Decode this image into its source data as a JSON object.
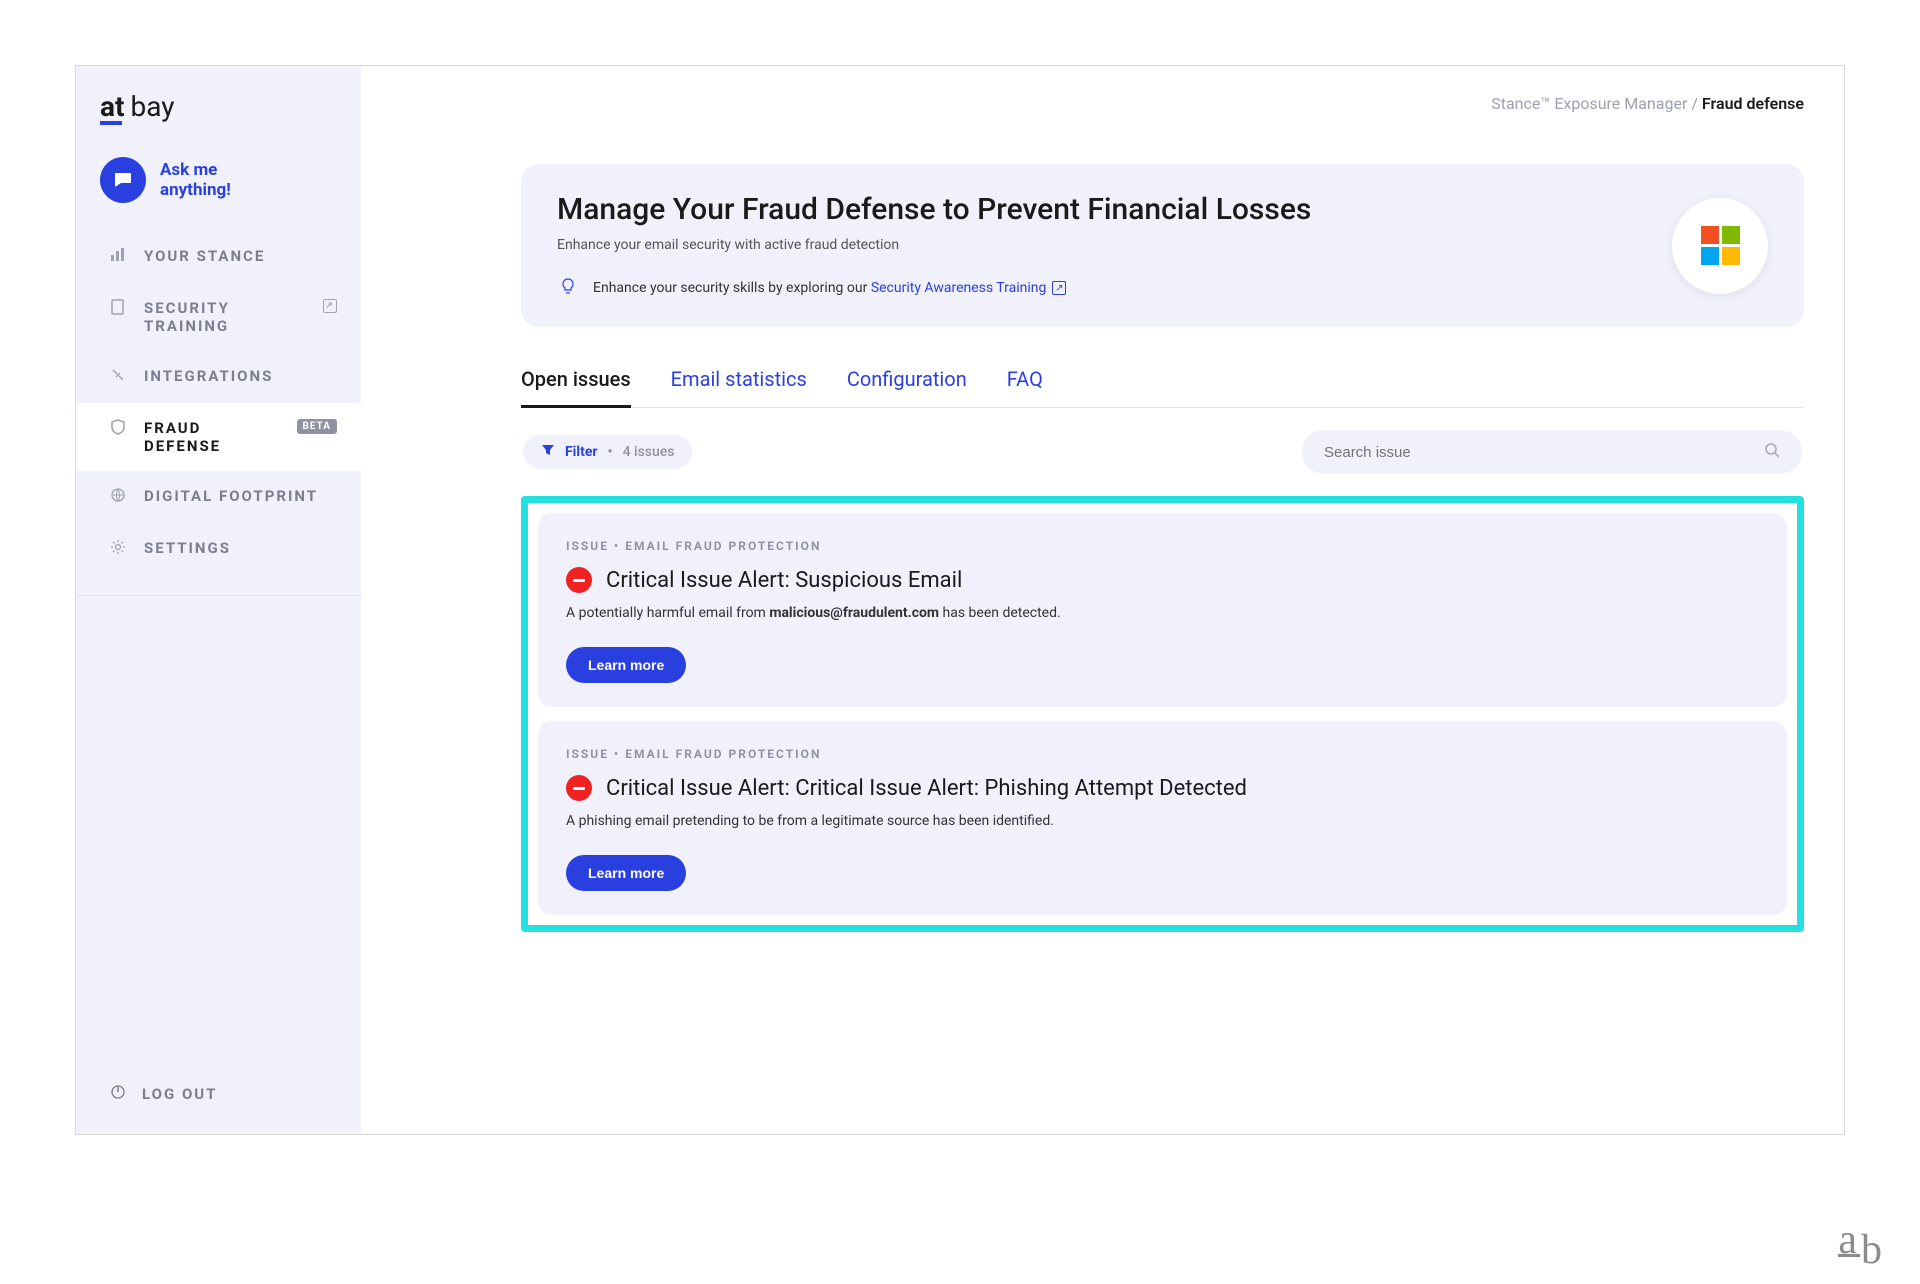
{
  "logo": {
    "part1": "at",
    "part2": "bay"
  },
  "ask": {
    "line1": "Ask me",
    "line2": "anything!"
  },
  "sidebar": {
    "items": [
      {
        "label": "YOUR STANCE"
      },
      {
        "label": "SECURITY TRAINING"
      },
      {
        "label": "INTEGRATIONS"
      },
      {
        "label": "FRAUD DEFENSE",
        "badge": "BETA"
      },
      {
        "label": "DIGITAL FOOTPRINT"
      },
      {
        "label": "SETTINGS"
      }
    ],
    "logout": "LOG OUT"
  },
  "breadcrumb": {
    "parent": "Stance™ Exposure Manager",
    "sep": " / ",
    "current": "Fraud defense"
  },
  "hero": {
    "title": "Manage Your Fraud Defense to Prevent Financial Losses",
    "subtitle": "Enhance your email security with active fraud detection",
    "tip_prefix": "Enhance your security skills by exploring our ",
    "tip_link": "Security Awareness Training"
  },
  "tabs": [
    {
      "label": "Open issues",
      "active": true
    },
    {
      "label": "Email statistics"
    },
    {
      "label": "Configuration"
    },
    {
      "label": "FAQ"
    }
  ],
  "filter": {
    "label": "Filter",
    "dot": "•",
    "count": "4 issues"
  },
  "search": {
    "placeholder": "Search issue"
  },
  "issues": [
    {
      "meta": "ISSUE • EMAIL FRAUD PROTECTION",
      "title": "Critical Issue Alert: Suspicious Email",
      "desc_pre": "A potentially harmful email from ",
      "desc_bold": "malicious@fraudulent.com",
      "desc_post": " has been detected.",
      "button": "Learn more"
    },
    {
      "meta": "ISSUE • EMAIL FRAUD PROTECTION",
      "title": "Critical Issue Alert: Critical Issue Alert: Phishing Attempt Detected",
      "desc_pre": "A phishing email pretending to be from a legitimate source has been identified.",
      "desc_bold": "",
      "desc_post": "",
      "button": "Learn more"
    }
  ],
  "ab_mark": {
    "a": "a",
    "b": "b"
  }
}
